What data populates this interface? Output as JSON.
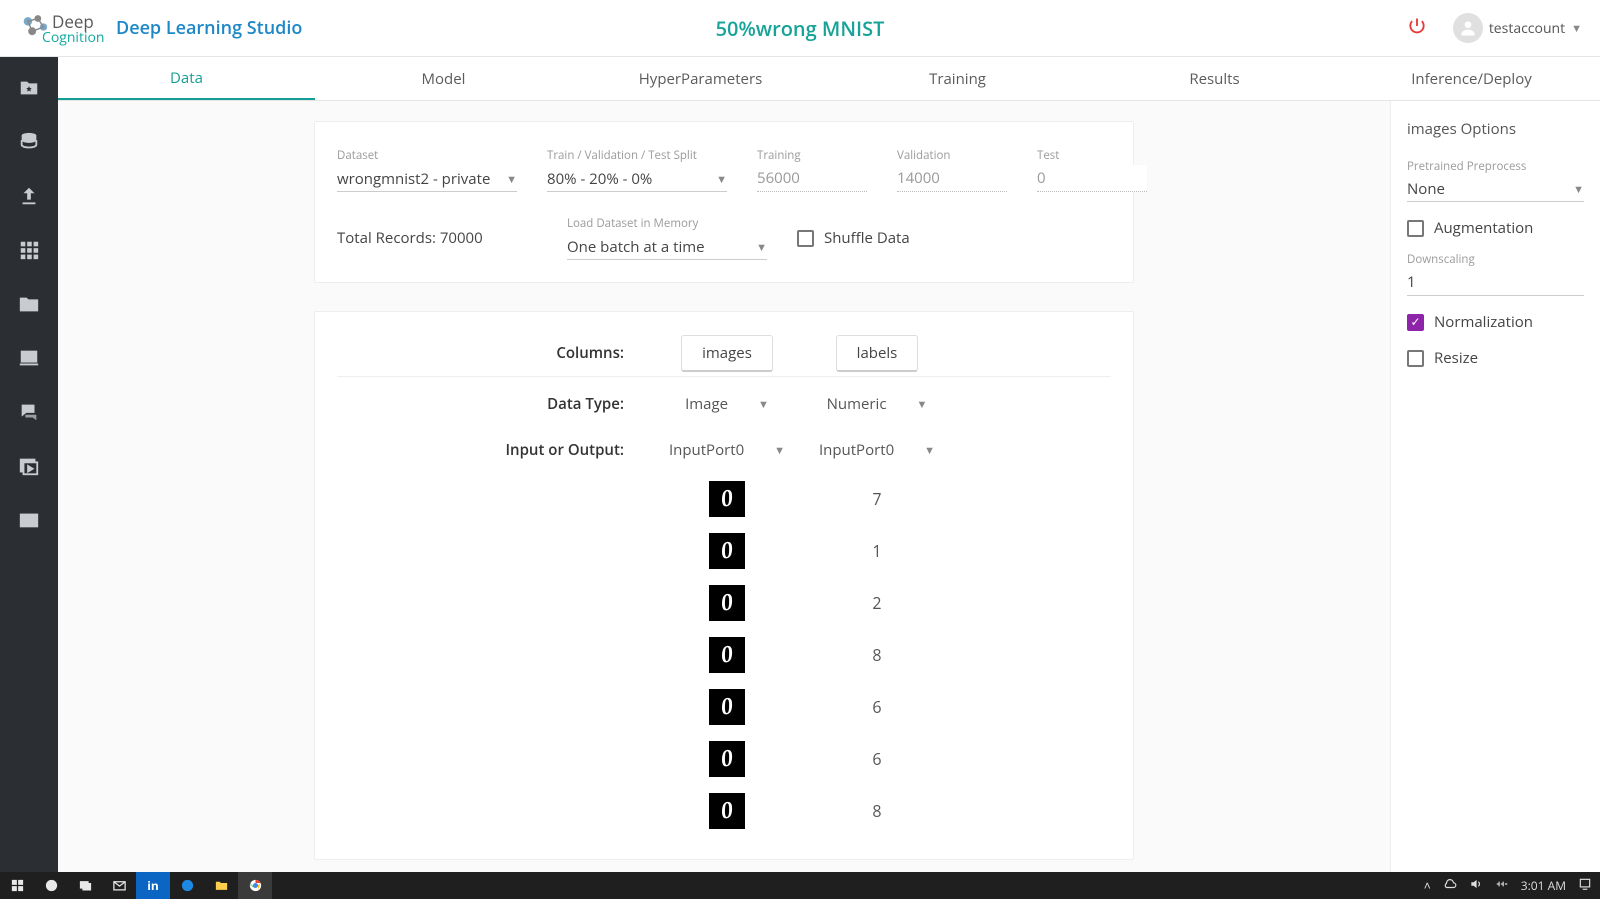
{
  "brand": {
    "deep": "Deep",
    "cog": "Cognition",
    "title": "Deep Learning Studio"
  },
  "project_title": "50%wrong MNIST",
  "user": {
    "name": "testaccount"
  },
  "tabs": [
    "Data",
    "Model",
    "HyperParameters",
    "Training",
    "Results",
    "Inference/Deploy"
  ],
  "active_tab": 0,
  "dataset_card": {
    "dataset_label": "Dataset",
    "dataset_value": "wrongmnist2 - private",
    "split_label": "Train / Validation / Test Split",
    "split_value": "80% - 20% - 0%",
    "training_label": "Training",
    "training_value": "56000",
    "validation_label": "Validation",
    "validation_value": "14000",
    "test_label": "Test",
    "test_value": "0",
    "total_label": "Total Records: 70000",
    "load_label": "Load Dataset in Memory",
    "load_value": "One batch at a time",
    "shuffle_label": "Shuffle Data",
    "shuffle_checked": false
  },
  "columns_card": {
    "columns_label": "Columns:",
    "col_a": "images",
    "col_b": "labels",
    "datatype_label": "Data Type:",
    "datatype_a": "Image",
    "datatype_b": "Numeric",
    "io_label": "Input or Output:",
    "io_a": "InputPort0",
    "io_b": "InputPort0",
    "rows": [
      {
        "glyph": "0",
        "label": "7"
      },
      {
        "glyph": "0",
        "label": "1"
      },
      {
        "glyph": "0",
        "label": "2"
      },
      {
        "glyph": "0",
        "label": "8"
      },
      {
        "glyph": "0",
        "label": "6"
      },
      {
        "glyph": "0",
        "label": "6"
      },
      {
        "glyph": "0",
        "label": "8"
      }
    ]
  },
  "right_panel": {
    "title": "images Options",
    "pre_label": "Pretrained Preprocess",
    "pre_value": "None",
    "aug_label": "Augmentation",
    "aug_checked": false,
    "down_label": "Downscaling",
    "down_value": "1",
    "norm_label": "Normalization",
    "norm_checked": true,
    "resize_label": "Resize",
    "resize_checked": false
  },
  "taskbar": {
    "time": "3:01 AM"
  }
}
